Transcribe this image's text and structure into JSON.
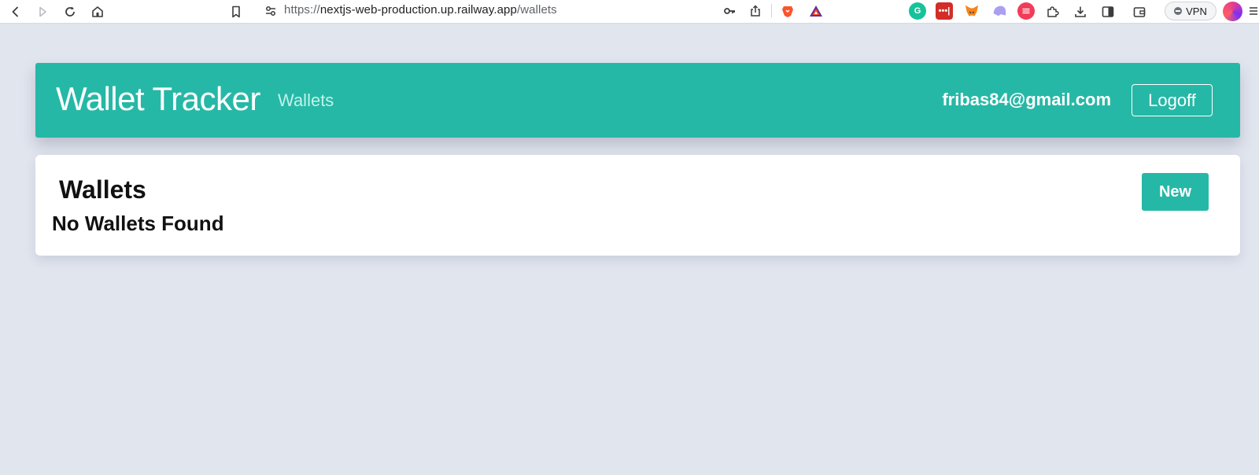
{
  "browser": {
    "url_scheme": "https://",
    "url_host": "nextjs-web-production.up.railway.app",
    "url_path": "/wallets",
    "vpn_label": "VPN",
    "icons": {
      "back": "back-arrow-icon",
      "forward": "forward-arrow-icon",
      "reload": "reload-icon",
      "home": "home-icon",
      "bookmark": "bookmark-icon",
      "site_settings": "tune-icon",
      "password": "key-icon",
      "share": "share-icon",
      "brave": "brave-lion-icon",
      "rewards": "bat-triangle-icon",
      "extensions": [
        "grammarly-icon",
        "lastpass-icon",
        "metamask-fox-icon",
        "phantom-ghost-icon",
        "red-circle-extension-icon",
        "puzzle-icon",
        "download-icon",
        "sidebar-icon",
        "wallet-icon"
      ],
      "avatar": "profile-avatar-icon",
      "menu": "menu-icon"
    }
  },
  "header": {
    "brand": "Wallet Tracker",
    "nav_link": "Wallets",
    "user_email": "fribas84@gmail.com",
    "logoff_label": "Logoff"
  },
  "main": {
    "title": "Wallets",
    "empty_message": "No Wallets Found",
    "new_button_label": "New"
  },
  "colors": {
    "accent": "#26b8a6",
    "page_background": "#e1e5ee",
    "nav_link": "#bff3ea",
    "text_dark": "#111111"
  }
}
